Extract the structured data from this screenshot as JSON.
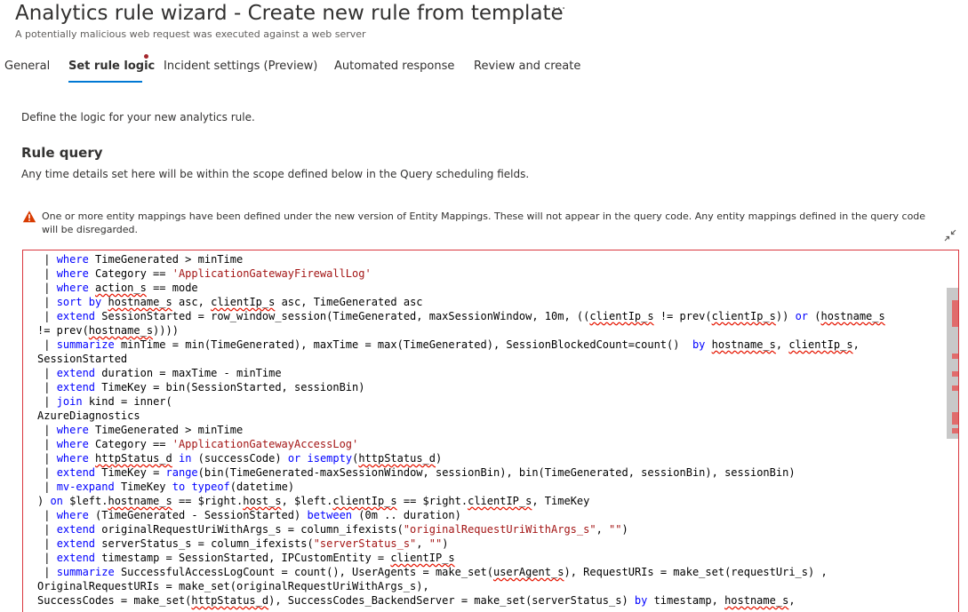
{
  "header": {
    "title": "Analytics rule wizard - Create new rule from template",
    "more_label": "···",
    "subtitle": "A potentially malicious web request was executed against a web server"
  },
  "tabs": [
    {
      "label": "General",
      "active": false
    },
    {
      "label": "Set rule logic",
      "active": true
    },
    {
      "label": "Incident settings (Preview)",
      "active": false
    },
    {
      "label": "Automated response",
      "active": false
    },
    {
      "label": "Review and create",
      "active": false
    }
  ],
  "content": {
    "intro": "Define the logic for your new analytics rule.",
    "rule_query_heading": "Rule query",
    "rule_query_desc": "Any time details set here will be within the scope defined below in the Query scheduling fields.",
    "warning": "One or more entity mappings have been defined under the new version of Entity Mappings. These will not appear in the query code. Any entity mappings defined in the query code will be disregarded."
  },
  "colors": {
    "accent": "#0078d4",
    "error_border": "#d9363e",
    "warning_icon": "#d83b01",
    "keyword": "#0000ff",
    "string": "#a31515"
  },
  "icons": {
    "more": "ellipsis-icon",
    "warning": "warning-triangle-icon",
    "collapse": "collapse-arrows-icon"
  },
  "editor": {
    "lines": [
      " | where TimeGenerated > minTime",
      " | where Category == 'ApplicationGatewayFirewallLog'",
      " | where action_s == mode",
      " | sort by hostname_s asc, clientIp_s asc, TimeGenerated asc",
      " | extend SessionStarted = row_window_session(TimeGenerated, maxSessionWindow, 10m, ((clientIp_s != prev(clientIp_s)) or (hostname_s",
      "!= prev(hostname_s))))",
      " | summarize minTime = min(TimeGenerated), maxTime = max(TimeGenerated), SessionBlockedCount=count()  by hostname_s, clientIp_s,",
      "SessionStarted",
      " | extend duration = maxTime - minTime",
      " | extend TimeKey = bin(SessionStarted, sessionBin)",
      " | join kind = inner(",
      "AzureDiagnostics",
      " | where TimeGenerated > minTime",
      " | where Category == 'ApplicationGatewayAccessLog'",
      " | where httpStatus_d in (successCode) or isempty(httpStatus_d)",
      " | extend TimeKey = range(bin(TimeGenerated-maxSessionWindow, sessionBin), bin(TimeGenerated, sessionBin), sessionBin)",
      " | mv-expand TimeKey to typeof(datetime)",
      ") on $left.hostname_s == $right.host_s, $left.clientIp_s == $right.clientIP_s, TimeKey",
      " | where (TimeGenerated - SessionStarted) between (0m .. duration)",
      " | extend originalRequestUriWithArgs_s = column_ifexists(\"originalRequestUriWithArgs_s\", \"\")",
      " | extend serverStatus_s = column_ifexists(\"serverStatus_s\", \"\")",
      " | extend timestamp = SessionStarted, IPCustomEntity = clientIP_s",
      " | summarize SuccessfulAccessLogCount = count(), UserAgents = make_set(userAgent_s), RequestURIs = make_set(requestUri_s) ,",
      "OriginalRequestURIs = make_set(originalRequestUriWithArgs_s),",
      "SuccessCodes = make_set(httpStatus_d), SuccessCodes_BackendServer = make_set(serverStatus_s) by timestamp, hostname_s,"
    ]
  }
}
